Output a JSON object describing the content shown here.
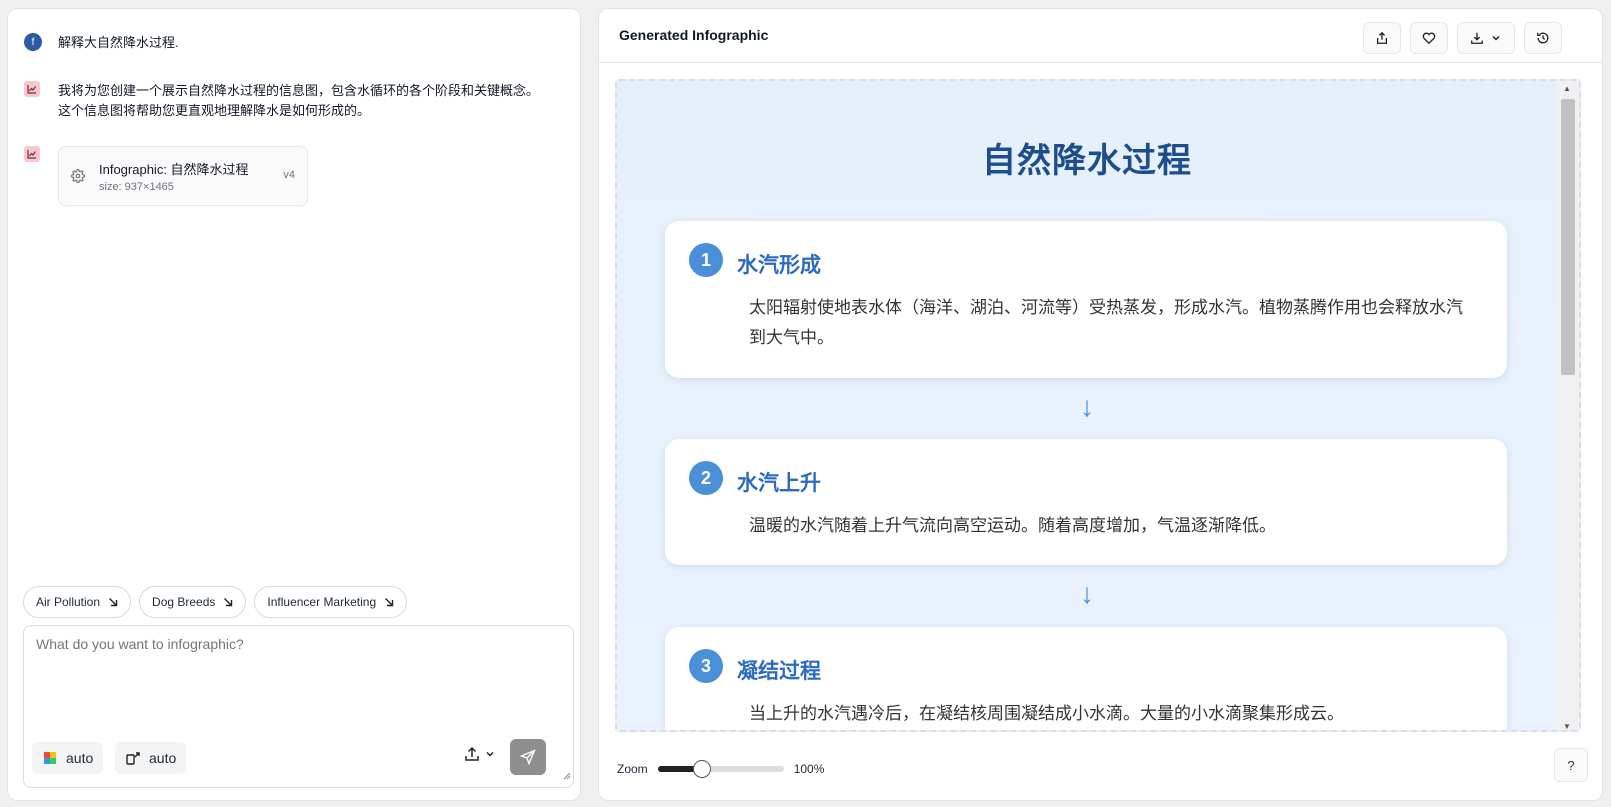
{
  "chat": {
    "user_initial": "f",
    "user_message": "解释大自然降水过程.",
    "bot_message": "我将为您创建一个展示自然降水过程的信息图，包含水循环的各个阶段和关键概念。这个信息图将帮助您更直观地理解降水是如何形成的。",
    "card": {
      "title": "Infographic: 自然降水过程",
      "size": "size: 937×1465",
      "version": "v4"
    }
  },
  "suggestions": [
    {
      "label": "Air Pollution"
    },
    {
      "label": "Dog Breeds"
    },
    {
      "label": "Influencer Marketing"
    }
  ],
  "composer": {
    "placeholder": "What do you want to infographic?",
    "style_label": "auto",
    "size_label": "auto"
  },
  "viewer": {
    "title": "Generated Infographic",
    "zoom_label": "Zoom",
    "zoom_value": "100%",
    "zoom_fraction": 0.35,
    "help_label": "?"
  },
  "infographic": {
    "title": "自然降水过程",
    "steps": [
      {
        "num": "1",
        "title": "水汽形成",
        "desc": "太阳辐射使地表水体（海洋、湖泊、河流等）受热蒸发，形成水汽。植物蒸腾作用也会释放水汽到大气中。"
      },
      {
        "num": "2",
        "title": "水汽上升",
        "desc": "温暖的水汽随着上升气流向高空运动。随着高度增加，气温逐渐降低。"
      },
      {
        "num": "3",
        "title": "凝结过程",
        "desc": "当上升的水汽遇冷后，在凝结核周围凝结成小水滴。大量的小水滴聚集形成云。"
      }
    ],
    "arrow": "↓"
  },
  "colors": {
    "accent": "#4a90d9",
    "title": "#1e4d8c",
    "step_title": "#2c6bbd",
    "send_button": "#8e8e8e"
  }
}
